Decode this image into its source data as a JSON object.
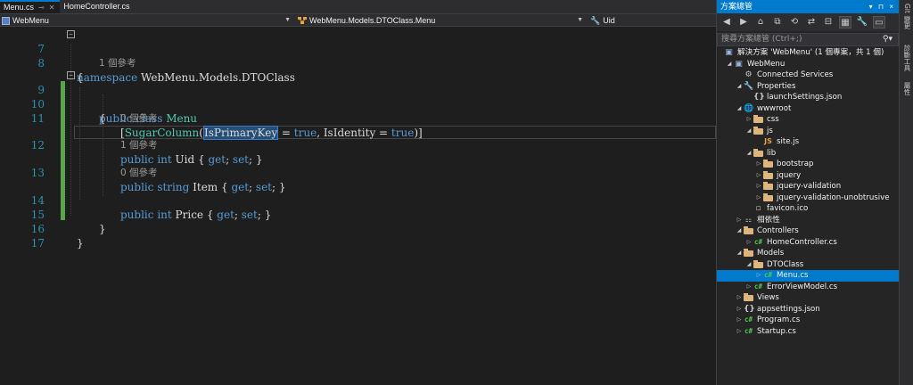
{
  "tabs": [
    {
      "label": "Menu.cs",
      "active": true
    },
    {
      "label": "HomeController.cs",
      "active": false
    }
  ],
  "nav": {
    "project": "WebMenu",
    "type": "WebMenu.Models.DTOClass.Menu",
    "member": "Uid"
  },
  "code": {
    "line_numbers": [
      "7",
      "8",
      "9",
      "10",
      "11",
      "12",
      "13",
      "14",
      "15",
      "16",
      "17"
    ],
    "namespace_kw": "namespace",
    "namespace_name": "WebMenu.Models.DTOClass",
    "open_brace": "{",
    "close_brace": "}",
    "refs_1": "1 個參考",
    "class_kw1": "public",
    "class_kw2": "class",
    "class_name": "Menu",
    "attr_open": "[",
    "attr_name": "SugarColumn",
    "attr_paren": "(",
    "attr_key": "IsPrimaryKey",
    "attr_eq1": " = ",
    "attr_val1": "true",
    "attr_sep": ", IsIdentity = ",
    "attr_val2": "true",
    "attr_close": ")]",
    "refs_uid": "0 個參考",
    "uid_kw1": "public",
    "uid_type": "int",
    "uid_name": "Uid",
    "refs_item": "1 個參考",
    "item_kw1": "public",
    "item_type": "string",
    "item_name": "Item",
    "refs_price": "0 個參考",
    "price_kw1": "public",
    "price_type": "int",
    "price_name": "Price",
    "prop_open": " { ",
    "get_kw": "get",
    "set_kw": "set",
    "prop_close": "; }",
    "semi_sp": "; "
  },
  "explorer": {
    "title": "方案總管",
    "title_controls": "▾ ⊓ ×",
    "search_placeholder": "搜尋方案總管 (Ctrl+;)",
    "items": [
      {
        "label": "解決方案 'WebMenu' (1 個專案，共 1 個)",
        "icon": "solution-icon"
      },
      {
        "label": "WebMenu",
        "icon": "project-icon"
      },
      {
        "label": "Connected Services",
        "icon": "connected-services-icon"
      },
      {
        "label": "Properties",
        "icon": "wrench-icon"
      },
      {
        "label": "launchSettings.json",
        "icon": "json-file-icon"
      },
      {
        "label": "wwwroot",
        "icon": "globe-icon"
      },
      {
        "label": "css",
        "icon": "folder-icon"
      },
      {
        "label": "js",
        "icon": "folder-icon"
      },
      {
        "label": "site.js",
        "icon": "js-file-icon"
      },
      {
        "label": "lib",
        "icon": "folder-icon"
      },
      {
        "label": "bootstrap",
        "icon": "folder-icon"
      },
      {
        "label": "jquery",
        "icon": "folder-icon"
      },
      {
        "label": "jquery-validation",
        "icon": "folder-icon"
      },
      {
        "label": "jquery-validation-unobtrusive",
        "icon": "folder-icon"
      },
      {
        "label": "favicon.ico",
        "icon": "ico-file-icon"
      },
      {
        "label": "相依性",
        "icon": "dependencies-icon"
      },
      {
        "label": "Controllers",
        "icon": "folder-icon"
      },
      {
        "label": "HomeController.cs",
        "icon": "cs-file-icon"
      },
      {
        "label": "Models",
        "icon": "folder-icon"
      },
      {
        "label": "DTOClass",
        "icon": "folder-icon"
      },
      {
        "label": "Menu.cs",
        "icon": "cs-file-icon"
      },
      {
        "label": "ErrorViewModel.cs",
        "icon": "cs-file-icon"
      },
      {
        "label": "Views",
        "icon": "folder-icon"
      },
      {
        "label": "appsettings.json",
        "icon": "json-file-icon"
      },
      {
        "label": "Program.cs",
        "icon": "cs-file-icon"
      },
      {
        "label": "Startup.cs",
        "icon": "cs-file-icon"
      }
    ]
  },
  "side_tabs": [
    "Git 變更",
    "診斷工具",
    "屬性"
  ],
  "colors": {
    "accent": "#007acc",
    "keyword": "#569cd6",
    "type": "#4ec9b0",
    "line_number": "#2b91af",
    "change_bar": "#57a64a"
  }
}
